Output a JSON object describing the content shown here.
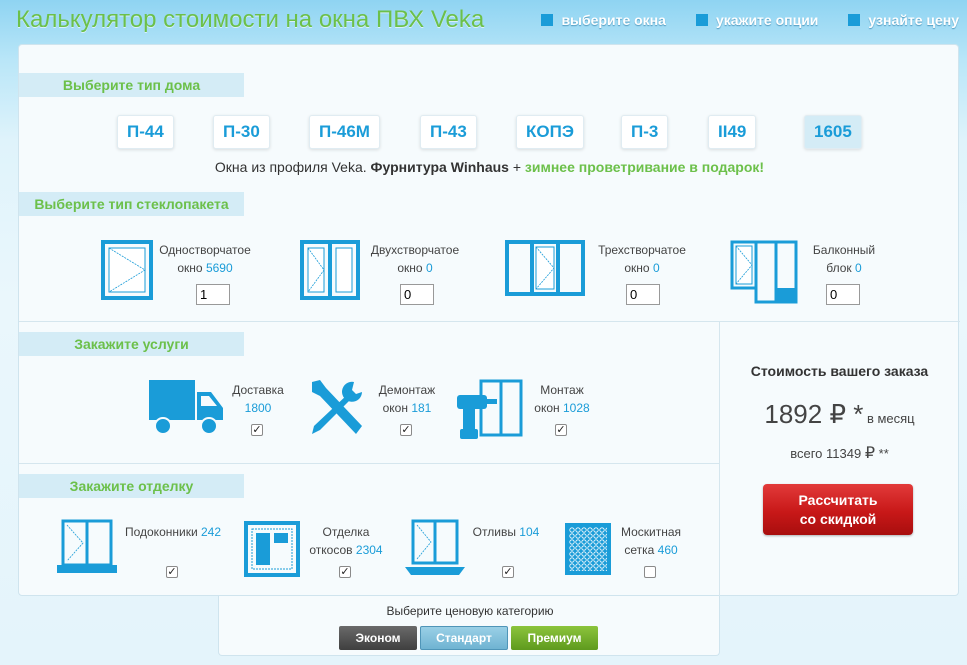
{
  "header": {
    "title": "Калькулятор стоимости на окна ПВХ Veka",
    "steps": [
      "выберите окна",
      "укажите опции",
      "узнайте цену"
    ]
  },
  "house_section": {
    "label": "Выберите тип дома",
    "types": [
      "П-44",
      "П-30",
      "П-46М",
      "П-43",
      "КОПЭ",
      "П-3",
      "II49",
      "1605"
    ],
    "active_type": "1605",
    "promo_plain": "Окна из профиля Veka. ",
    "promo_bold": "Фурнитура Winhaus",
    "promo_plus": " + ",
    "promo_green": "зимнее проветривание в подарок!"
  },
  "glass_section": {
    "label": "Выберите тип стеклопакета",
    "items": [
      {
        "line1": "Одностворчатое",
        "line2": "окно",
        "price": "5690",
        "qty": "1"
      },
      {
        "line1": "Двухстворчатое",
        "line2": "окно",
        "price": "0",
        "qty": "0"
      },
      {
        "line1": "Трехстворчатое",
        "line2": "окно",
        "price": "0",
        "qty": "0"
      },
      {
        "line1": "Балконный",
        "line2": "блок",
        "price": "0",
        "qty": "0"
      }
    ]
  },
  "services_section": {
    "label": "Закажите услуги",
    "items": [
      {
        "line1": "Доставка",
        "line2": "",
        "price": "1800",
        "checked": true
      },
      {
        "line1": "Демонтаж",
        "line2": "окон",
        "price": "181",
        "checked": true
      },
      {
        "line1": "Монтаж",
        "line2": "окон",
        "price": "1028",
        "checked": true
      }
    ]
  },
  "finish_section": {
    "label": "Закажите отделку",
    "items": [
      {
        "line1": "Подоконники",
        "line2": "",
        "price": "242",
        "checked": true
      },
      {
        "line1": "Отделка",
        "line2": "откосов",
        "price": "2304",
        "checked": true
      },
      {
        "line1": "Отливы",
        "line2": "",
        "price": "104",
        "checked": true
      },
      {
        "line1": "Москитная",
        "line2": "сетка",
        "price": "460",
        "checked": false
      }
    ]
  },
  "summary": {
    "title": "Стоимость вашего заказа",
    "monthly": "1892",
    "currency": "₽",
    "star": " *",
    "monthly_suffix": " в месяц",
    "total_prefix": "всего ",
    "total": "11349",
    "total_suffix": " **",
    "button_line1": "Рассчитать",
    "button_line2": "со скидкой"
  },
  "price_category": {
    "label": "Выберите ценовую категорию",
    "options": [
      "Эконом",
      "Стандарт",
      "Премиум"
    ],
    "selected": "Стандарт"
  },
  "colors": {
    "accent_blue": "#1a9cd8",
    "accent_green": "#6cc04a",
    "button_red": "#c81818"
  }
}
